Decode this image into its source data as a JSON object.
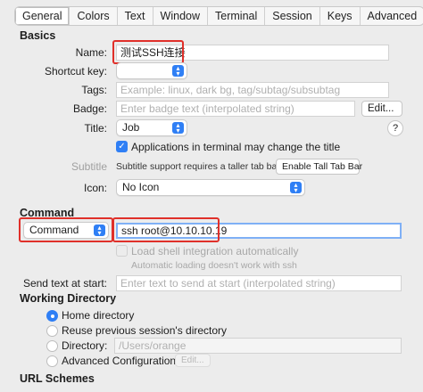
{
  "tabs": [
    "General",
    "Colors",
    "Text",
    "Window",
    "Terminal",
    "Session",
    "Keys",
    "Advanced"
  ],
  "basics": {
    "header": "Basics",
    "name_label": "Name:",
    "name_value": "测试SSH连接",
    "shortcut_label": "Shortcut key:",
    "tags_label": "Tags:",
    "tags_placeholder": "Example: linux, dark bg, tag/subtag/subsubtag",
    "badge_label": "Badge:",
    "badge_placeholder": "Enter badge text (interpolated string)",
    "badge_edit": "Edit...",
    "title_label": "Title:",
    "title_value": "Job",
    "help": "?",
    "apps_title_checkbox": "Applications in terminal may change the title",
    "subtitle_label": "Subtitle",
    "subtitle_note": "Subtitle support requires a taller tab bar.",
    "enable_tall_tab_bar": "Enable Tall Tab Bar",
    "icon_label": "Icon:",
    "icon_value": "No Icon"
  },
  "command": {
    "header": "Command",
    "type_value": "Command",
    "command_value": "ssh root@10.10.10.19",
    "load_shell_integration": "Load shell integration automatically",
    "auto_loading_note": "Automatic loading doesn't work with ssh",
    "send_text_label": "Send text at start:",
    "send_text_placeholder": "Enter text to send at start (interpolated string)"
  },
  "working_directory": {
    "header": "Working Directory",
    "home": "Home directory",
    "reuse": "Reuse previous session's directory",
    "directory_label": "Directory:",
    "directory_value": "/Users/orange",
    "advanced": "Advanced Configuration",
    "advanced_edit": "Edit..."
  },
  "url_schemes": {
    "header": "URL Schemes"
  },
  "colors": {
    "accent": "#2f7ff5",
    "highlight": "#e0302a"
  }
}
